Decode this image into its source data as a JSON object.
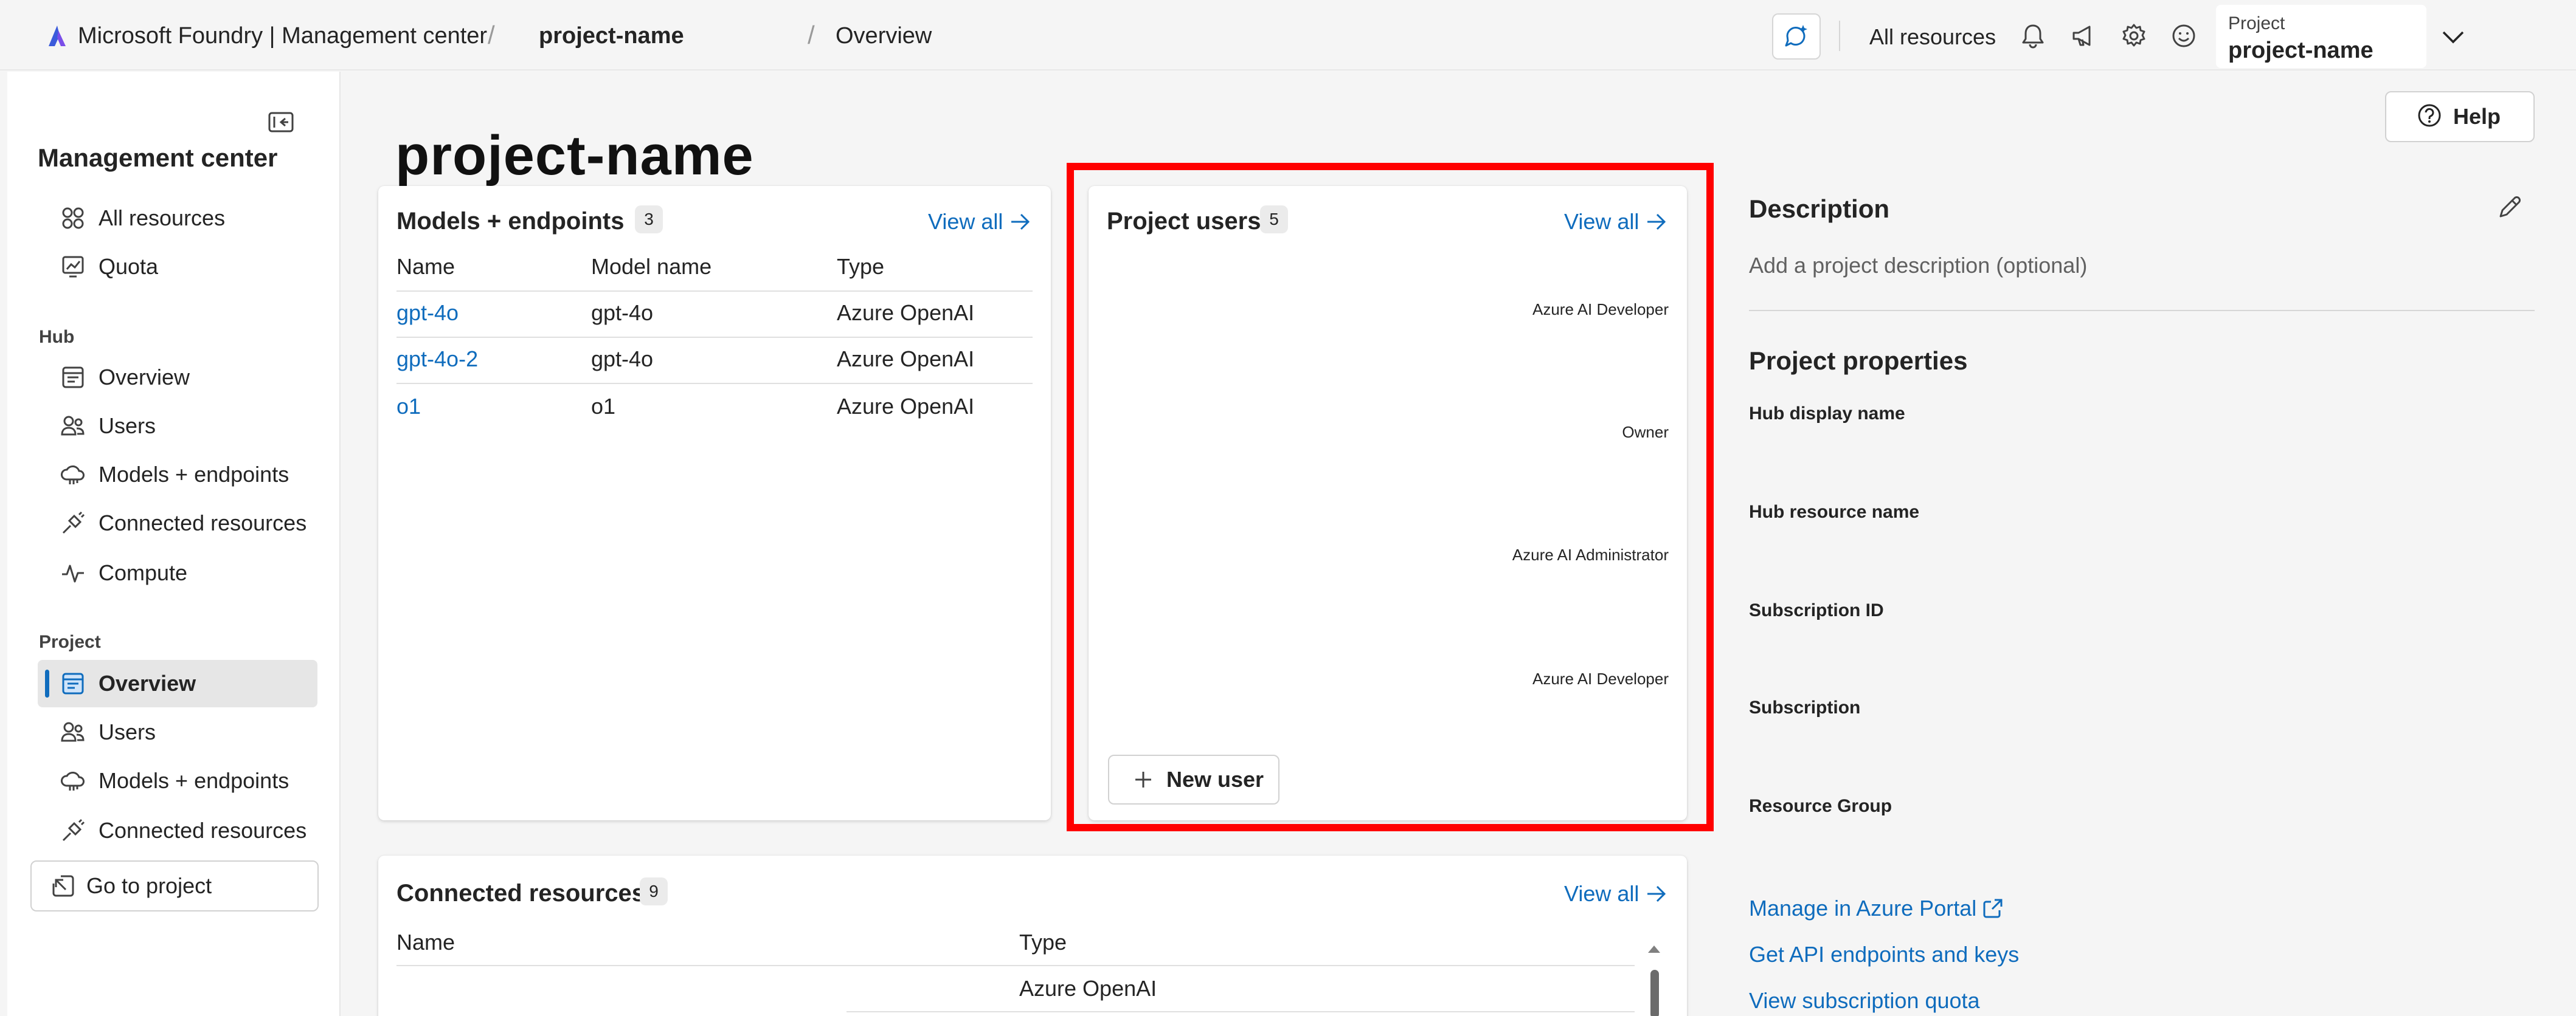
{
  "topbar": {
    "brand": "Microsoft Foundry | Management center",
    "breadcrumb_project": "project-name",
    "breadcrumb_page": "Overview",
    "all_resources": "All resources",
    "project_label": "Project",
    "project_value": "project-name"
  },
  "sidebar": {
    "title": "Management center",
    "top_items": [
      {
        "label": "All resources",
        "icon": "apps-icon"
      },
      {
        "label": "Quota",
        "icon": "quota-icon"
      }
    ],
    "hub_section": "Hub",
    "hub_items": [
      {
        "label": "Overview",
        "icon": "overview-icon"
      },
      {
        "label": "Users",
        "icon": "users-icon"
      },
      {
        "label": "Models + endpoints",
        "icon": "cloud-icon"
      },
      {
        "label": "Connected resources",
        "icon": "plug-icon"
      },
      {
        "label": "Compute",
        "icon": "pulse-icon"
      }
    ],
    "project_section": "Project",
    "project_items": [
      {
        "label": "Overview",
        "icon": "overview-icon",
        "active": true
      },
      {
        "label": "Users",
        "icon": "users-icon"
      },
      {
        "label": "Models + endpoints",
        "icon": "cloud-icon"
      },
      {
        "label": "Connected resources",
        "icon": "plug-icon"
      }
    ],
    "go_to_project": "Go to project"
  },
  "main": {
    "title": "project-name",
    "help": "Help",
    "models": {
      "title": "Models + endpoints",
      "count": "3",
      "view_all": "View all",
      "columns": [
        "Name",
        "Model name",
        "Type"
      ],
      "rows": [
        [
          "gpt-4o",
          "gpt-4o",
          "Azure OpenAI"
        ],
        [
          "gpt-4o-2",
          "gpt-4o",
          "Azure OpenAI"
        ],
        [
          "o1",
          "o1",
          "Azure OpenAI"
        ]
      ]
    },
    "users": {
      "title": "Project users",
      "count": "5",
      "view_all": "View all",
      "roles": [
        "Azure AI Developer",
        "Owner",
        "Azure AI Administrator",
        "Azure AI Developer"
      ],
      "new_user": "New user"
    },
    "connected": {
      "title": "Connected resources",
      "count": "9",
      "view_all": "View all",
      "columns": [
        "Name",
        "Type"
      ],
      "rows": [
        [
          "",
          "Azure OpenAI"
        ]
      ]
    }
  },
  "details": {
    "description_heading": "Description",
    "description_placeholder": "Add a project description (optional)",
    "properties_heading": "Project properties",
    "properties": [
      "Hub display name",
      "Hub resource name",
      "Subscription ID",
      "Subscription",
      "Resource Group"
    ],
    "links": [
      "Manage in Azure Portal",
      "Get API endpoints and keys",
      "View subscription quota"
    ]
  },
  "colors": {
    "accent": "#0f6cbd",
    "highlight": "#ff0000",
    "background": "#f5f5f5"
  }
}
